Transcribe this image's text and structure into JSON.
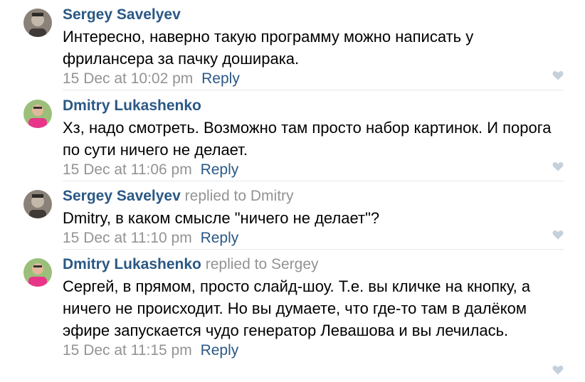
{
  "comments": [
    {
      "author": "Sergey Savelyev",
      "replied": "",
      "text": "Интересно, наверно такую программу можно написать у фрилансера за пачку доширака.",
      "time": "15 Dec at 10:02 pm",
      "reply_label": "Reply",
      "avatar": "avatar-gray"
    },
    {
      "author": "Dmitry Lukashenko",
      "replied": "",
      "text": "Хз, надо смотреть. Возможно там просто набор картинок. И порога по сути ничего не делает.",
      "time": "15 Dec at 11:06 pm",
      "reply_label": "Reply",
      "avatar": "avatar-pink"
    },
    {
      "author": "Sergey Savelyev",
      "replied": "replied to Dmitry",
      "text": "Dmitry, в каком смысле \"ничего не делает\"?",
      "time": "15 Dec at 11:10 pm",
      "reply_label": "Reply",
      "avatar": "avatar-gray"
    },
    {
      "author": "Dmitry Lukashenko",
      "replied": "replied to Sergey",
      "text": "Сергей, в прямом, просто слайд-шоу. Т.е. вы кличке на кнопку, а ничего не происходит. Но вы думаете, что где-то там в далёком эфире запускается чудо генератор Левашова и вы лечилась.",
      "time": "15 Dec at 11:15 pm",
      "reply_label": "Reply",
      "avatar": "avatar-pink"
    }
  ],
  "colors": {
    "link": "#2a5885",
    "meta": "#939393",
    "like": "#c5d0db"
  },
  "icons": {
    "like": "heart-icon"
  }
}
